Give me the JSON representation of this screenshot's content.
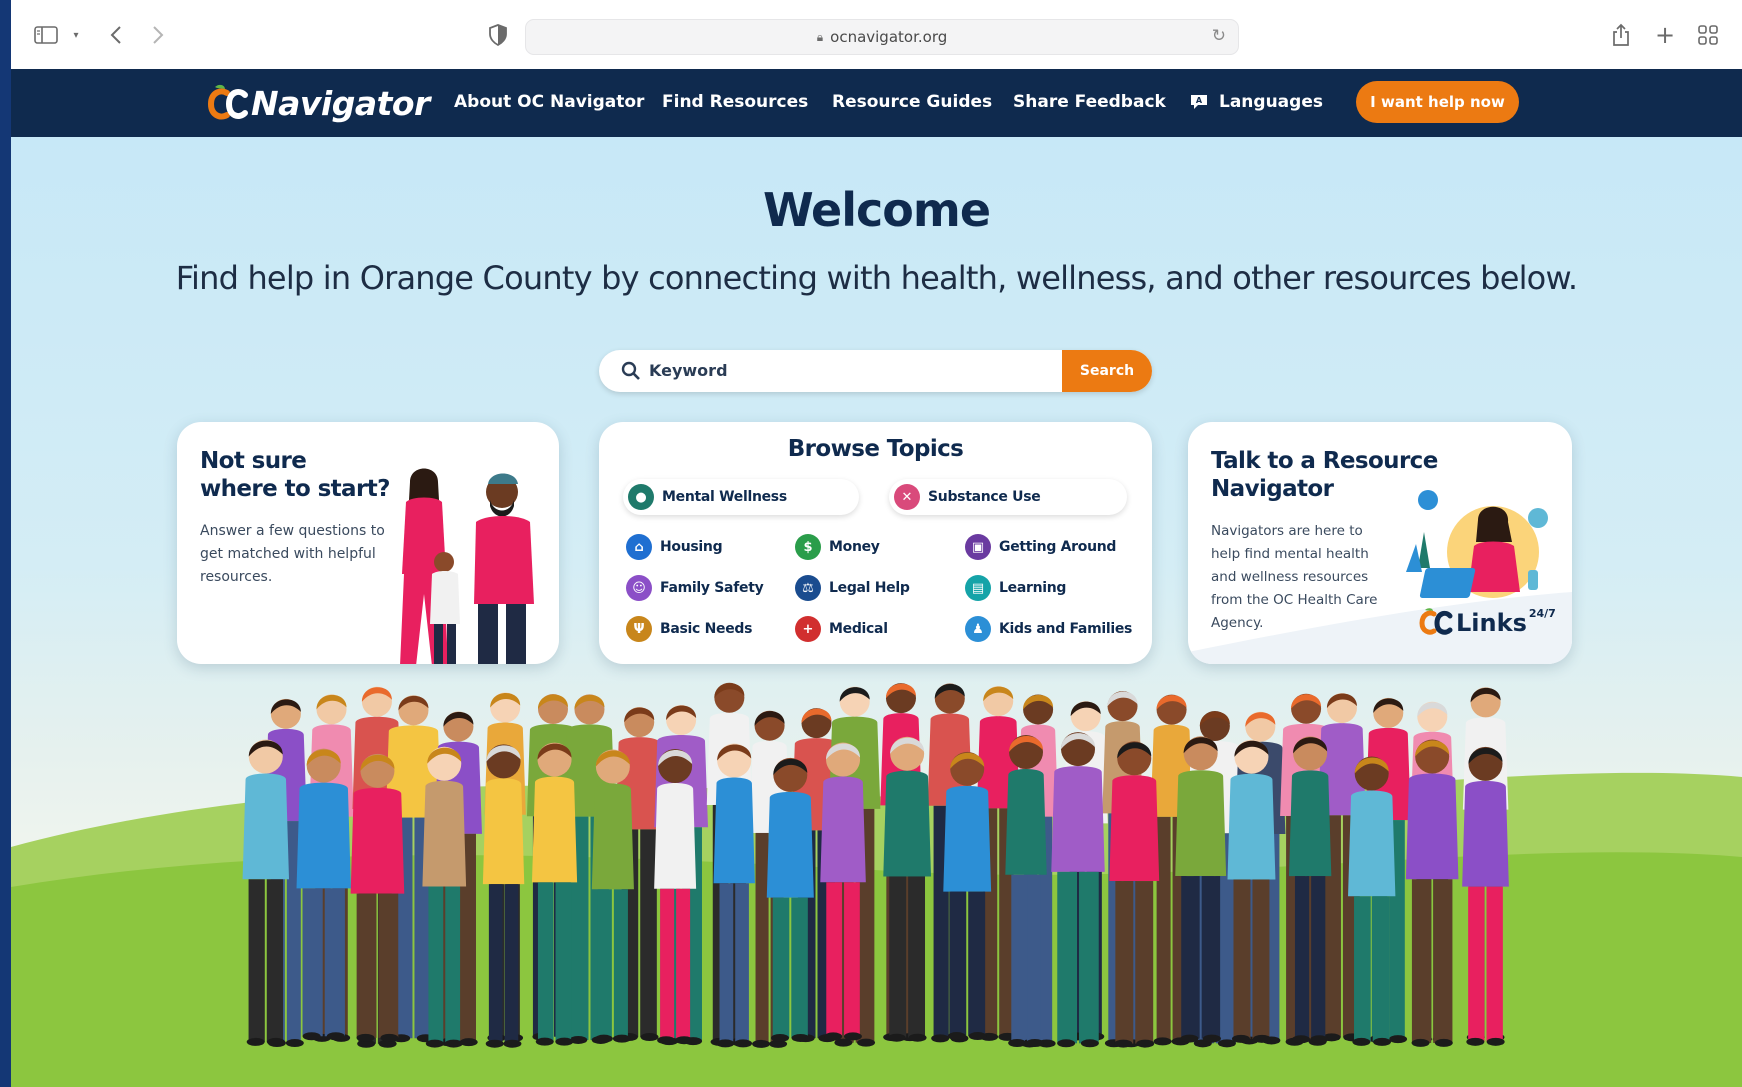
{
  "browser": {
    "url": "ocnavigator.org"
  },
  "nav": {
    "logo_text": "Navigator",
    "logo_mark": "OC",
    "links": [
      "About OC Navigator",
      "Find Resources",
      "Resource Guides",
      "Share Feedback",
      "Languages"
    ],
    "cta": "I want help now"
  },
  "hero": {
    "title": "Welcome",
    "subtitle": "Find help in Orange County by connecting with health, wellness, and other resources below."
  },
  "search": {
    "placeholder": "Keyword",
    "button": "Search"
  },
  "card_start": {
    "title": "Not sure where to start?",
    "body": "Answer a few questions to get matched with helpful resources."
  },
  "browse": {
    "title": "Browse Topics",
    "featured": [
      {
        "label": "Mental Wellness",
        "color": "#1f7a6b"
      },
      {
        "label": "Substance Use",
        "color": "#d94a7b"
      }
    ],
    "topics": [
      {
        "label": "Housing",
        "color": "#1f6fd1"
      },
      {
        "label": "Money",
        "color": "#2a9d4a"
      },
      {
        "label": "Getting Around",
        "color": "#6a3aa0"
      },
      {
        "label": "Family Safety",
        "color": "#8b4fc7"
      },
      {
        "label": "Legal Help",
        "color": "#1a4c8f"
      },
      {
        "label": "Learning",
        "color": "#15a3a8"
      },
      {
        "label": "Basic Needs",
        "color": "#c8861b"
      },
      {
        "label": "Medical",
        "color": "#d12f2f"
      },
      {
        "label": "Kids and Families",
        "color": "#2c8fd6"
      }
    ]
  },
  "card_navigator": {
    "title": "Talk to a Resource Navigator",
    "body": "Navigators are here to help find mental health and wellness resources from the OC Health Care Agency.",
    "badge_mark": "OC",
    "badge": "Links",
    "badge_sup": "24/7"
  },
  "colors": {
    "nav_bg": "#0f2a4e",
    "accent": "#ec7a12",
    "hero_sky": "#c7e8f7",
    "grass": "#8cc63f"
  }
}
